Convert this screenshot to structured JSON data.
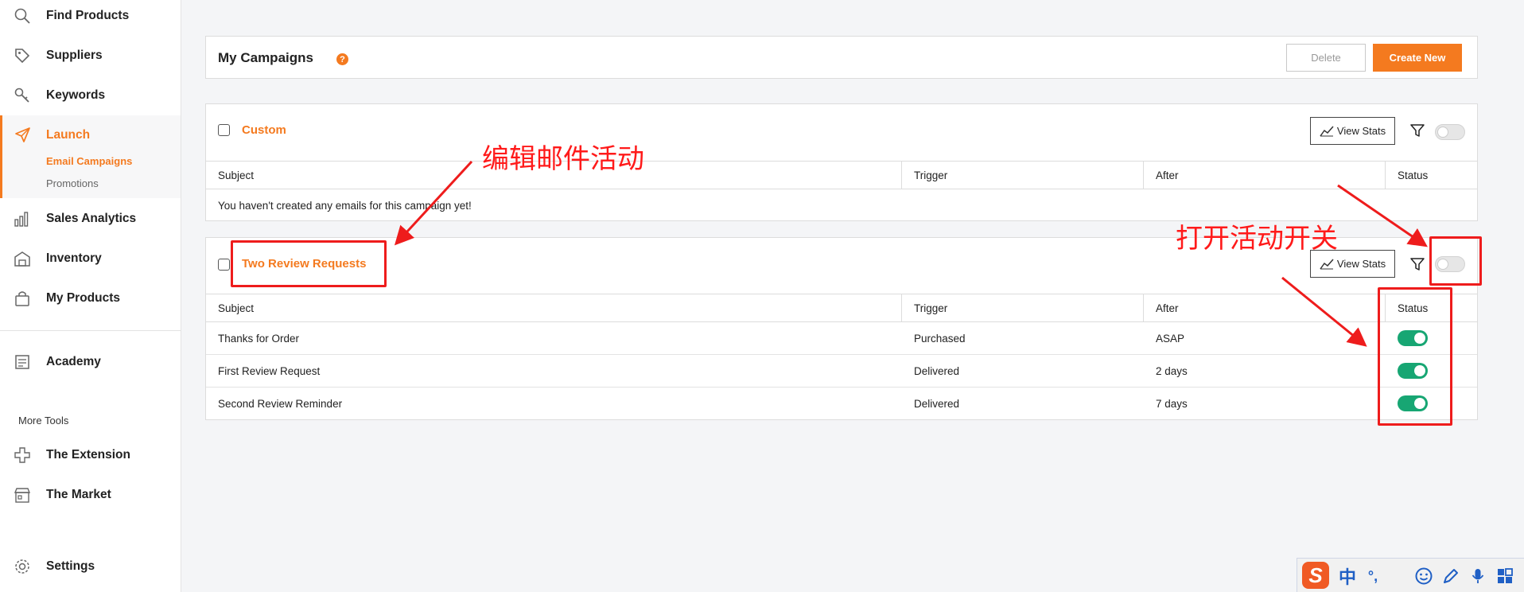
{
  "sidebar": {
    "nav": [
      {
        "label": "Find Products",
        "icon": "search-icon"
      },
      {
        "label": "Suppliers",
        "icon": "tag-icon"
      },
      {
        "label": "Keywords",
        "icon": "key-icon"
      },
      {
        "label": "Launch",
        "icon": "rocket-icon"
      },
      {
        "label": "Sales Analytics",
        "icon": "bar-chart-icon"
      },
      {
        "label": "Inventory",
        "icon": "warehouse-icon"
      },
      {
        "label": "My Products",
        "icon": "box-icon"
      },
      {
        "label": "Academy",
        "icon": "book-icon"
      },
      {
        "label": "The Extension",
        "icon": "puzzle-icon"
      },
      {
        "label": "The Market",
        "icon": "store-icon"
      },
      {
        "label": "Settings",
        "icon": "gear-icon"
      }
    ],
    "launch_sub": [
      {
        "label": "Email Campaigns",
        "active": true
      },
      {
        "label": "Promotions",
        "active": false
      }
    ],
    "more_tools_label": "More Tools"
  },
  "header": {
    "title": "My Campaigns",
    "help": "?",
    "delete_label": "Delete",
    "create_label": "Create New"
  },
  "columns": [
    "Subject",
    "Trigger",
    "After",
    "Status"
  ],
  "campaigns": [
    {
      "name": "Custom",
      "view_stats_label": "View Stats",
      "enabled": false,
      "empty_message": "You haven't created any emails for this campaign yet!",
      "rows": []
    },
    {
      "name": "Two Review Requests",
      "view_stats_label": "View Stats",
      "enabled": false,
      "rows": [
        {
          "subject": "Thanks for Order",
          "trigger": "Purchased",
          "after": "ASAP",
          "status": true
        },
        {
          "subject": "First Review Request",
          "trigger": "Delivered",
          "after": "2 days",
          "status": true
        },
        {
          "subject": "Second Review Reminder",
          "trigger": "Delivered",
          "after": "7 days",
          "status": true
        }
      ]
    }
  ],
  "annotations": {
    "edit_email_campaign": "编辑邮件活动",
    "open_campaign_switch": "打开活动开关",
    "color": "#ff1a1a"
  },
  "ime_toolbar": {
    "logo": "S",
    "lang": "中",
    "punct": "°,",
    "items": [
      "emoji-icon",
      "pen-icon",
      "mic-icon",
      "grid-icon"
    ]
  },
  "colors": {
    "accent": "#f47a1f",
    "toggle_on": "#17a673",
    "annotation": "#ee1c1c"
  }
}
